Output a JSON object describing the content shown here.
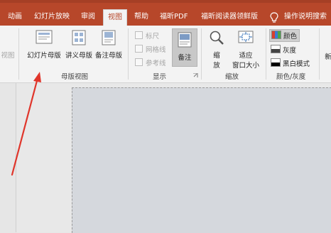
{
  "tabs": [
    {
      "label": "动画"
    },
    {
      "label": "幻灯片放映"
    },
    {
      "label": "审阅"
    },
    {
      "label": "视图"
    },
    {
      "label": "帮助"
    },
    {
      "label": "福昕PDF"
    },
    {
      "label": "福昕阅读器领鲜版"
    },
    {
      "label": "操作说明搜索"
    }
  ],
  "ribbon": {
    "partial_left": "视图",
    "master_views": {
      "group_label": "母版视图",
      "slide_master": "幻灯片母版",
      "handout_master": "讲义母版",
      "notes_master": "备注母版"
    },
    "show": {
      "group_label": "显示",
      "ruler": "标尺",
      "gridlines": "网格线",
      "guides": "参考线",
      "notes": "备注"
    },
    "zoom": {
      "group_label": "缩放",
      "zoom_line1": "缩",
      "zoom_line2": "放",
      "fit_line1": "适应",
      "fit_line2": "窗口大小"
    },
    "color": {
      "group_label": "颜色/灰度",
      "color": "颜色",
      "grayscale": "灰度",
      "bw": "黑白模式"
    },
    "partial_right": "新"
  },
  "colors": {
    "tab_bar": "#b7472a",
    "ribbon_bg": "#f3f3f3",
    "arrow": "#e0352b",
    "slide_bg": "#d5d8dd"
  }
}
